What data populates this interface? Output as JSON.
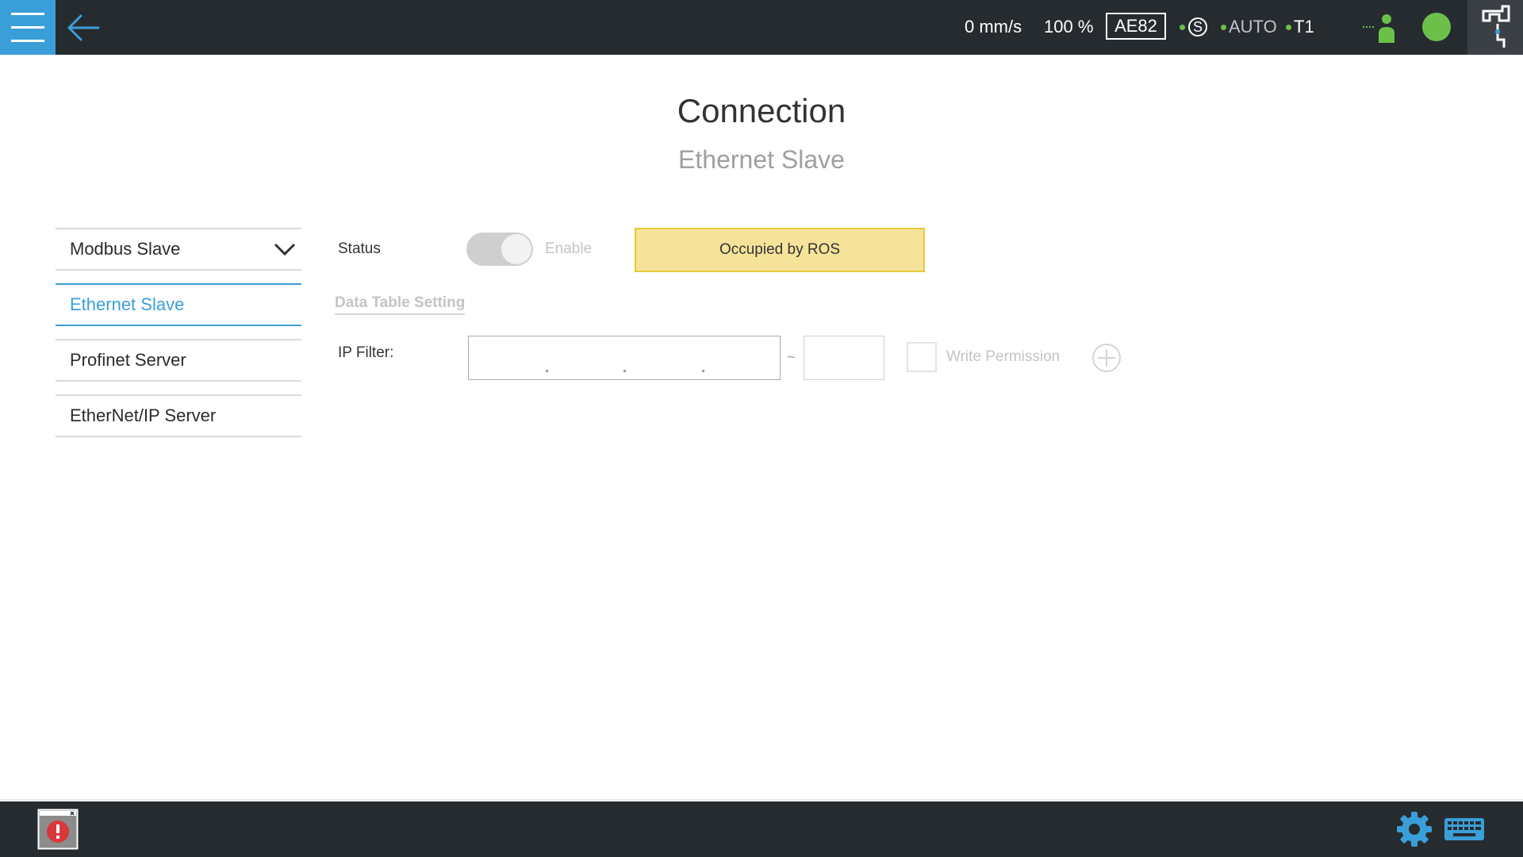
{
  "topbar": {
    "speed": "0 mm/s",
    "override": "100 %",
    "robot_id": "AE82",
    "safety_symbol": "S",
    "mode": "AUTO",
    "operation_mode": "T1",
    "status_color": "#6cc04a",
    "accent_color": "#3a9fd8",
    "icons": [
      "menu-icon",
      "back-arrow-icon",
      "safety-icon",
      "user-icon",
      "status-light-icon",
      "tool-icon"
    ]
  },
  "header": {
    "title": "Connection",
    "subtitle": "Ethernet Slave"
  },
  "sidebar": {
    "items": [
      {
        "label": "Modbus Slave",
        "expanded": true
      },
      {
        "label": "Ethernet Slave",
        "active": true
      },
      {
        "label": "Profinet Server"
      },
      {
        "label": "EtherNet/IP Server"
      }
    ]
  },
  "main": {
    "status_label": "Status",
    "toggle_label": "Enable",
    "toggle_on": false,
    "banner": "Occupied by ROS",
    "section_title": "Data Table Setting",
    "ip_filter_label": "IP Filter:",
    "ip_value": "",
    "range_separator": "~",
    "ip_end_value": "",
    "write_permission_label": "Write Permission",
    "write_permission_checked": false
  },
  "bottombar": {
    "icons": [
      "alarm-icon",
      "settings-gear-icon",
      "keyboard-icon"
    ]
  }
}
